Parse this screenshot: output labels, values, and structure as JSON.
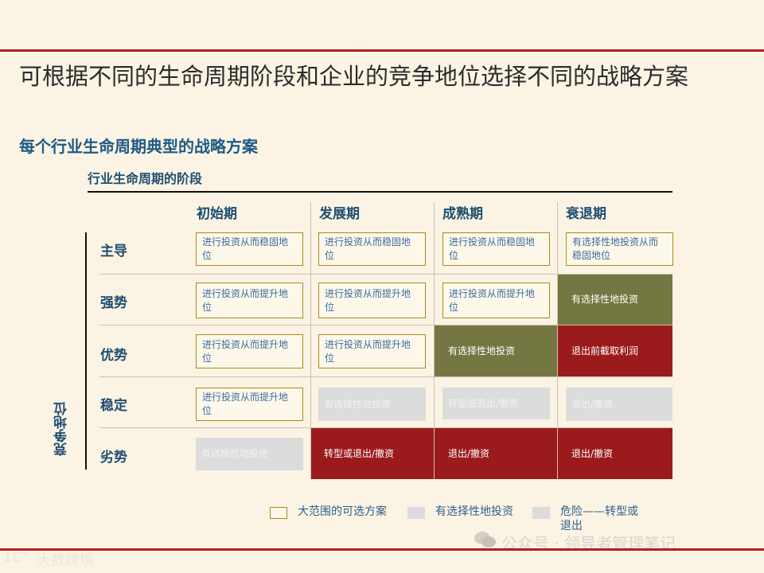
{
  "title": "可根据不同的生命周期阶段和企业的竞争地位选择不同的战略方案",
  "subtitle": "每个行业生命周期典型的战略方案",
  "axes": {
    "lifecycle_label": "行业生命周期的阶段",
    "position_label": "竞争地位"
  },
  "columns": [
    "初始期",
    "发展期",
    "成熟期",
    "衰退期"
  ],
  "rows": [
    "主导",
    "强势",
    "优势",
    "稳定",
    "劣势"
  ],
  "cells": [
    [
      "进行投资从而稳固地位",
      "进行投资从而稳固地位",
      "进行投资从而稳固地位",
      "有选择性地投资从而稳固地位"
    ],
    [
      "进行投资从而提升地位",
      "进行投资从而提升地位",
      "进行投资从而提升地位",
      "有选择性地投资"
    ],
    [
      "进行投资从而提升地位",
      "进行投资从而提升地位",
      "有选择性地投资",
      "退出前截取利润"
    ],
    [
      "进行投资从而提升地位",
      "有选择性地投资",
      "转型或退出/撤资",
      "退出/撤资"
    ],
    [
      "有选择性地投资",
      "转型或退出/撤资",
      "退出/撤资",
      "退出/撤资"
    ]
  ],
  "legend": [
    "大范围的可选方案",
    "有选择性地投资",
    "危险——转型或退出"
  ],
  "colors": {
    "wide": "#fdf8ea",
    "wide_border": "#a88a1c",
    "selective": "#dcdcdc",
    "olive": "#747741",
    "danger": "#9b1a1c",
    "accent_line": "#b51d24"
  },
  "watermarks": {
    "left": "大数跨境",
    "right": "公众号 · 领导者管理笔记"
  }
}
